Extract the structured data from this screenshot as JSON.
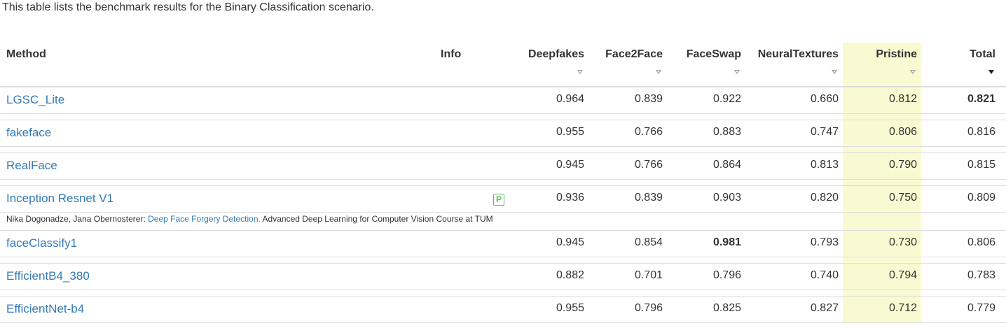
{
  "intro": "This table lists the benchmark results for the Binary Classification scenario.",
  "header": {
    "method": "Method",
    "info": "Info",
    "deepfakes": "Deepfakes",
    "face2face": "Face2Face",
    "faceswap": "FaceSwap",
    "neuraltextures": "NeuralTextures",
    "pristine": "Pristine",
    "total": "Total"
  },
  "highlight_color": "#fafad2",
  "link_color": "#337ab7",
  "rows": [
    {
      "method": "LGSC_Lite",
      "deepfakes": "0.964",
      "face2face": "0.839",
      "faceswap": "0.922",
      "neuraltextures": "0.660",
      "pristine": "0.812",
      "total": "0.821"
    },
    {
      "method": "fakeface",
      "deepfakes": "0.955",
      "face2face": "0.766",
      "faceswap": "0.883",
      "neuraltextures": "0.747",
      "pristine": "0.806",
      "total": "0.816"
    },
    {
      "method": "RealFace",
      "deepfakes": "0.945",
      "face2face": "0.766",
      "faceswap": "0.864",
      "neuraltextures": "0.813",
      "pristine": "0.790",
      "total": "0.815"
    },
    {
      "method": "Inception Resnet V1",
      "info_badge": "P",
      "deepfakes": "0.936",
      "face2face": "0.839",
      "faceswap": "0.903",
      "neuraltextures": "0.820",
      "pristine": "0.750",
      "total": "0.809",
      "note": {
        "authors": "Nika Dogonadze, Jana Obernosterer: ",
        "link": "Deep Face Forgery Detection.",
        "rest": " Advanced Deep Learning for Computer Vision Course at TUM"
      }
    },
    {
      "method": "faceClassify1",
      "deepfakes": "0.945",
      "face2face": "0.854",
      "faceswap": "0.981",
      "neuraltextures": "0.793",
      "pristine": "0.730",
      "total": "0.806"
    },
    {
      "method": "EfficientB4_380",
      "deepfakes": "0.882",
      "face2face": "0.701",
      "faceswap": "0.796",
      "neuraltextures": "0.740",
      "pristine": "0.794",
      "total": "0.783"
    },
    {
      "method": "EfficientNet-b4",
      "deepfakes": "0.955",
      "face2face": "0.796",
      "faceswap": "0.825",
      "neuraltextures": "0.827",
      "pristine": "0.712",
      "total": "0.779"
    }
  ]
}
